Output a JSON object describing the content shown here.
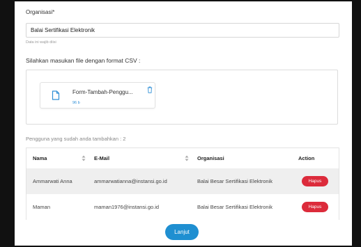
{
  "organisasi": {
    "label": "Organisasi*",
    "value": "Balai Sertifikasi Elektronik",
    "helper": "Data ini wajib diisi"
  },
  "upload": {
    "label": "Silahkan masukan file dengan format CSV :",
    "file_name": "Form-Tambah-Penggu...",
    "file_size": "96 b",
    "file_icon": "document-icon",
    "delete_icon": "trash-icon"
  },
  "users": {
    "count_text": "Pengguna yang sudah anda tambahkan : 2",
    "columns": [
      "Nama",
      "E-Mail",
      "Organisasi",
      "Action"
    ],
    "rows": [
      {
        "nama": "Ammarwati Anna",
        "email": "ammarwatianna@instansi.go.id",
        "organisasi": "Balai Besar Sertifikasi Elektronik",
        "action": "Hapus"
      },
      {
        "nama": "Maman",
        "email": "maman1976@instansi.go.id",
        "organisasi": "Balai Besar Sertifikasi Elektronik",
        "action": "Hapus"
      }
    ]
  },
  "footer": {
    "next_label": "Lanjut"
  },
  "colors": {
    "primary": "#1f8fd1",
    "danger": "#dc2b3b",
    "row_alt": "#efefef"
  }
}
